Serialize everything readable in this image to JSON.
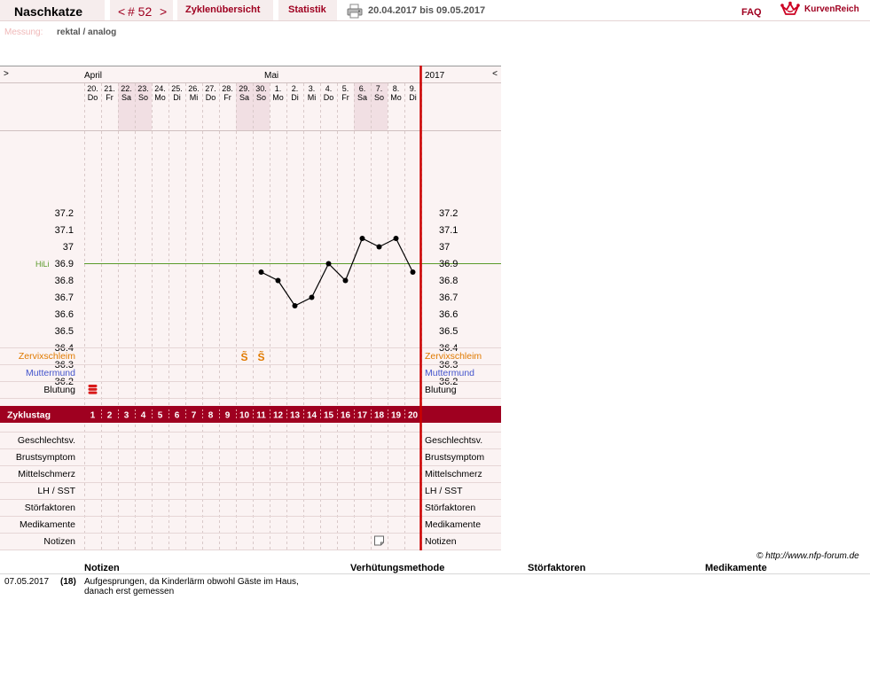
{
  "header": {
    "user_name": "Naschkatze",
    "cycle_prev": "<",
    "cycle_number": "# 52",
    "cycle_next": ">",
    "overview_tab": "Zyklenübersicht",
    "stats_tab": "Statistik",
    "date_range": "20.04.2017 bis 09.05.2017",
    "faq": "FAQ",
    "logo_text": "KurvenReich",
    "print_icon": "printer-icon",
    "logo_icon": "crown-icon"
  },
  "measurement": {
    "label": "Messung:",
    "value": "rektal / analog"
  },
  "chart_data": {
    "type": "line",
    "month_left": "April",
    "month_right": "Mai",
    "year": "2017",
    "nav_left": ">",
    "nav_right": "<",
    "days": [
      {
        "date": "20.",
        "wd": "Do",
        "weekend": false
      },
      {
        "date": "21.",
        "wd": "Fr",
        "weekend": false
      },
      {
        "date": "22.",
        "wd": "Sa",
        "weekend": true
      },
      {
        "date": "23.",
        "wd": "So",
        "weekend": true
      },
      {
        "date": "24.",
        "wd": "Mo",
        "weekend": false
      },
      {
        "date": "25.",
        "wd": "Di",
        "weekend": false
      },
      {
        "date": "26.",
        "wd": "Mi",
        "weekend": false
      },
      {
        "date": "27.",
        "wd": "Do",
        "weekend": false
      },
      {
        "date": "28.",
        "wd": "Fr",
        "weekend": false
      },
      {
        "date": "29.",
        "wd": "Sa",
        "weekend": true
      },
      {
        "date": "30.",
        "wd": "So",
        "weekend": true
      },
      {
        "date": "1.",
        "wd": "Mo",
        "weekend": false
      },
      {
        "date": "2.",
        "wd": "Di",
        "weekend": false
      },
      {
        "date": "3.",
        "wd": "Mi",
        "weekend": false
      },
      {
        "date": "4.",
        "wd": "Do",
        "weekend": false
      },
      {
        "date": "5.",
        "wd": "Fr",
        "weekend": false
      },
      {
        "date": "6.",
        "wd": "Sa",
        "weekend": true
      },
      {
        "date": "7.",
        "wd": "So",
        "weekend": true
      },
      {
        "date": "8.",
        "wd": "Mo",
        "weekend": false
      },
      {
        "date": "9.",
        "wd": "Di",
        "weekend": false
      }
    ],
    "y_ticks": [
      "37.2",
      "37.1",
      "37",
      "36.9",
      "36.8",
      "36.7",
      "36.6",
      "36.5",
      "36.4",
      "36.3",
      "36.2"
    ],
    "ylim": [
      36.1,
      37.3
    ],
    "hili_label": "HiLi",
    "hili_value": 36.9,
    "temperatures": [
      null,
      null,
      null,
      null,
      null,
      null,
      null,
      null,
      null,
      null,
      36.85,
      36.8,
      36.65,
      36.7,
      36.9,
      36.8,
      37.05,
      37.0,
      37.05,
      36.85
    ],
    "label_cervical": "Zervixschleim",
    "cervical_marks": [
      null,
      null,
      null,
      null,
      null,
      null,
      null,
      null,
      null,
      "S̃",
      "S̃",
      null,
      null,
      null,
      null,
      null,
      null,
      null,
      null,
      null
    ],
    "label_cervix": "Muttermund",
    "label_bleeding": "Blutung",
    "bleeding_days": [
      1
    ],
    "cycle_day_label": "Zyklustag",
    "cycle_days": [
      "1",
      "2",
      "3",
      "4",
      "5",
      "6",
      "7",
      "8",
      "9",
      "10",
      "11",
      "12",
      "13",
      "14",
      "15",
      "16",
      "17",
      "18",
      "19",
      "20"
    ],
    "extra_rows": [
      "Geschlechtsv.",
      "Brustsymptom",
      "Mittelschmerz",
      "LH / SST",
      "Störfaktoren",
      "Medikamente",
      "Notizen"
    ],
    "note_day": 18,
    "note_icon": "note-icon"
  },
  "copyright": "© http://www.nfp-forum.de",
  "notes_table": {
    "headers": [
      "Notizen",
      "Verhütungsmethode",
      "Störfaktoren",
      "Medikamente"
    ],
    "rows": [
      {
        "date": "07.05.2017",
        "day": "(18)",
        "text_lines": [
          "Aufgesprungen, da Kinderlärm obwohl Gäste im Haus,",
          "danach erst gemessen"
        ]
      }
    ]
  },
  "colors": {
    "accent": "#9f0020",
    "red_line": "#cc0000",
    "panel_bg": "#fbf3f3",
    "weekend_bg": "#f1dfe3",
    "cervical": "#e07a00",
    "cervix": "#4455cc",
    "hili_line": "#5a9a2a",
    "gray_text": "#555555",
    "placeholder": "#f0b8b8"
  }
}
